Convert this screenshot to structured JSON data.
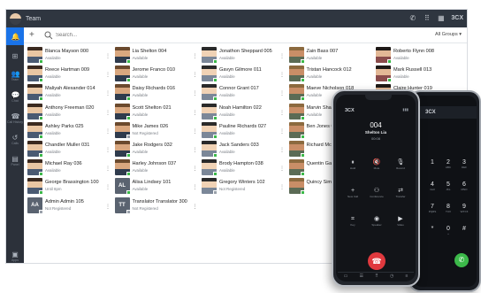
{
  "app": {
    "title": "Team",
    "brand": "3CX",
    "search_placeholder": "Search...",
    "groups_label": "All Groups ▾",
    "rail": [
      {
        "glyph": "🔔",
        "caption": "",
        "icon": "bell-icon"
      },
      {
        "glyph": "⊞",
        "caption": "",
        "icon": "windows-icon"
      },
      {
        "glyph": "👥",
        "caption": "Team",
        "icon": "team-icon"
      },
      {
        "glyph": "💬",
        "caption": "Chat",
        "icon": "chat-icon"
      },
      {
        "glyph": "☎",
        "caption": "Call History",
        "icon": "call-history-icon"
      },
      {
        "glyph": "↺",
        "caption": "Calls",
        "icon": "calls-icon"
      },
      {
        "glyph": "▤",
        "caption": "Panel",
        "icon": "panel-icon"
      },
      {
        "glyph": "▣",
        "caption": "Apps",
        "icon": "apps-icon"
      }
    ],
    "contacts": [
      {
        "name": "Blanca Mayson 000",
        "status": "Available",
        "initials": "",
        "available": true
      },
      {
        "name": "Lia Shelton 004",
        "status": "Available",
        "initials": "",
        "available": true
      },
      {
        "name": "Jonathon Sheppard 005",
        "status": "Available",
        "initials": "",
        "available": true
      },
      {
        "name": "Zain Bass 007",
        "status": "Available",
        "initials": "",
        "available": true
      },
      {
        "name": "Roberto Flynn 008",
        "status": "Available",
        "initials": "",
        "available": true
      },
      {
        "name": "Reece Hartman 009",
        "status": "Available",
        "initials": "",
        "available": true
      },
      {
        "name": "Jerome Franco 010",
        "status": "Available",
        "initials": "",
        "available": true
      },
      {
        "name": "Gavyn Gilmore 011",
        "status": "Available",
        "initials": "",
        "available": true
      },
      {
        "name": "Tristan Hancock 012",
        "status": "Available",
        "initials": "",
        "available": true
      },
      {
        "name": "Mark Russell 013",
        "status": "Available",
        "initials": "",
        "available": true
      },
      {
        "name": "Maliyah Alexander 014",
        "status": "Available",
        "initials": "",
        "available": true
      },
      {
        "name": "Daisy Richards 016",
        "status": "Available",
        "initials": "",
        "available": true
      },
      {
        "name": "Connor Grant 017",
        "status": "Available",
        "initials": "",
        "available": true
      },
      {
        "name": "Maeve Nicholson 018",
        "status": "Available",
        "initials": "",
        "available": true
      },
      {
        "name": "Claire Hunter 019",
        "status": "Available",
        "initials": "",
        "available": true
      },
      {
        "name": "Anthony Freeman 020",
        "status": "Available",
        "initials": "",
        "available": true
      },
      {
        "name": "Scott Shelton 021",
        "status": "Available",
        "initials": "",
        "available": true
      },
      {
        "name": "Noah Hamilton 022",
        "status": "Available",
        "initials": "",
        "available": true
      },
      {
        "name": "Marvin Shah 023",
        "status": "Available",
        "initials": "",
        "available": true
      },
      {
        "name": "Roland Wat",
        "status": "",
        "initials": "",
        "available": true
      },
      {
        "name": "Ashley Parks 025",
        "status": "Available",
        "initials": "",
        "available": true
      },
      {
        "name": "Mike James 026",
        "status": "Not Registered",
        "initials": "",
        "available": false
      },
      {
        "name": "Pauline Richards 027",
        "status": "Available",
        "initials": "",
        "available": true
      },
      {
        "name": "Ben Jones 02",
        "status": "",
        "initials": "",
        "available": true
      },
      {
        "name": "",
        "status": "",
        "initials": "",
        "available": true
      },
      {
        "name": "Chandler Muller 031",
        "status": "Available",
        "initials": "",
        "available": true
      },
      {
        "name": "Jake Rodgers 032",
        "status": "Available",
        "initials": "",
        "available": true
      },
      {
        "name": "Jack Sanders 033",
        "status": "Available",
        "initials": "",
        "available": true
      },
      {
        "name": "Richard Mcke",
        "status": "",
        "initials": "",
        "available": true
      },
      {
        "name": "",
        "status": "",
        "initials": "",
        "available": true
      },
      {
        "name": "Michael Ray 036",
        "status": "Available",
        "initials": "",
        "available": true
      },
      {
        "name": "Harley Johnson 037",
        "status": "Available",
        "initials": "",
        "available": true
      },
      {
        "name": "Brody Hampton 038",
        "status": "Available",
        "initials": "",
        "available": true
      },
      {
        "name": "Quentin Gam",
        "status": "",
        "initials": "",
        "available": true
      },
      {
        "name": "",
        "status": "",
        "initials": "",
        "available": true
      },
      {
        "name": "George Brassington 100",
        "status": "Until 8pm",
        "initials": "",
        "available": true
      },
      {
        "name": "Alisa Lindsey 101",
        "status": "Available",
        "initials": "AL",
        "available": true
      },
      {
        "name": "Gregory Winters 102",
        "status": "Not Registered",
        "initials": "",
        "available": false
      },
      {
        "name": "Quincy Simm",
        "status": "",
        "initials": "",
        "available": true
      },
      {
        "name": "",
        "status": "",
        "initials": "",
        "available": true
      },
      {
        "name": "Admin Admin 105",
        "status": "Not Registered",
        "initials": "AA",
        "available": false
      },
      {
        "name": "Translator Translator 300",
        "status": "Not Registered",
        "initials": "TT",
        "available": false
      }
    ]
  },
  "phone_front": {
    "brand": "3CX",
    "extension": "004",
    "caller": "Shelton Lia",
    "duration": "00:08",
    "controls": [
      {
        "glyph": "⏸",
        "label": "Hold",
        "icon": "hold-icon"
      },
      {
        "glyph": "🔇",
        "label": "Mute",
        "icon": "mute-icon"
      },
      {
        "glyph": "🎙",
        "label": "Record",
        "icon": "record-icon"
      },
      {
        "glyph": "+",
        "label": "New Call",
        "icon": "new-call-icon"
      },
      {
        "glyph": "⚇",
        "label": "Conference",
        "icon": "conference-icon"
      },
      {
        "glyph": "⇄",
        "label": "Transfer",
        "icon": "transfer-icon"
      },
      {
        "glyph": "⌗",
        "label": "Key",
        "icon": "keypad-icon"
      },
      {
        "glyph": "◉",
        "label": "Speaker",
        "icon": "speaker-icon"
      },
      {
        "glyph": "▶",
        "label": "Video",
        "icon": "video-icon"
      }
    ]
  },
  "phone_back": {
    "brand": "3CX",
    "keys": [
      {
        "d": "1",
        "s": ""
      },
      {
        "d": "2",
        "s": "ABC"
      },
      {
        "d": "3",
        "s": "DEF"
      },
      {
        "d": "4",
        "s": "GHI"
      },
      {
        "d": "5",
        "s": "JKL"
      },
      {
        "d": "6",
        "s": "MNO"
      },
      {
        "d": "7",
        "s": "PQRS"
      },
      {
        "d": "8",
        "s": "TUV"
      },
      {
        "d": "9",
        "s": "WXYZ"
      },
      {
        "d": "*",
        "s": ""
      },
      {
        "d": "0",
        "s": "+"
      },
      {
        "d": "#",
        "s": ""
      }
    ]
  },
  "colors": {
    "accent": "#1a73e8",
    "available": "#3cb94a",
    "hangup": "#e0393e",
    "titlebar": "#2f3640"
  }
}
